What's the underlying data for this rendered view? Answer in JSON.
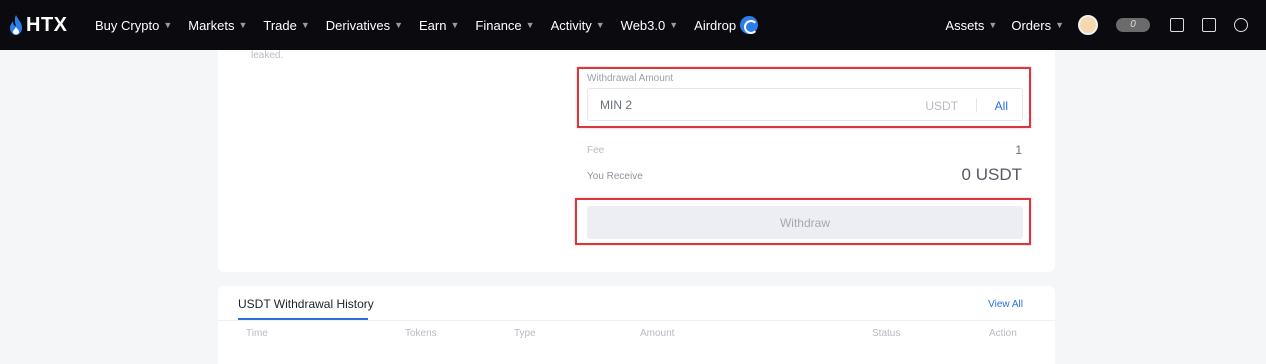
{
  "nav": {
    "logo_text": "HTX",
    "left_items": [
      {
        "label": "Buy Crypto"
      },
      {
        "label": "Markets"
      },
      {
        "label": "Trade"
      },
      {
        "label": "Derivatives"
      },
      {
        "label": "Earn"
      },
      {
        "label": "Finance"
      },
      {
        "label": "Activity"
      },
      {
        "label": "Web3.0"
      },
      {
        "label": "Airdrop"
      }
    ],
    "right_items": [
      {
        "label": "Assets"
      },
      {
        "label": "Orders"
      }
    ],
    "icons": [
      "avatar",
      "vip-badge-icon",
      "notes-icon",
      "download-icon",
      "globe-icon"
    ],
    "vip_text": "0"
  },
  "form": {
    "leaked_text": "leaked.",
    "amount_label": "Withdrawal Amount",
    "amount_placeholder": "MIN 2",
    "amount_unit": "USDT",
    "all_label": "All",
    "fee_label": "Fee",
    "fee_value": "1",
    "receive_label": "You Receive",
    "receive_value": "0 USDT",
    "withdraw_label": "Withdraw"
  },
  "history": {
    "title": "USDT Withdrawal History",
    "view_all": "View All",
    "columns": [
      "Time",
      "Tokens",
      "Type",
      "Amount",
      "Status",
      "Action"
    ]
  },
  "colors": {
    "nav_bg": "#0b0b0f",
    "accent": "#2b6fe0",
    "highlight": "#d9363e"
  }
}
